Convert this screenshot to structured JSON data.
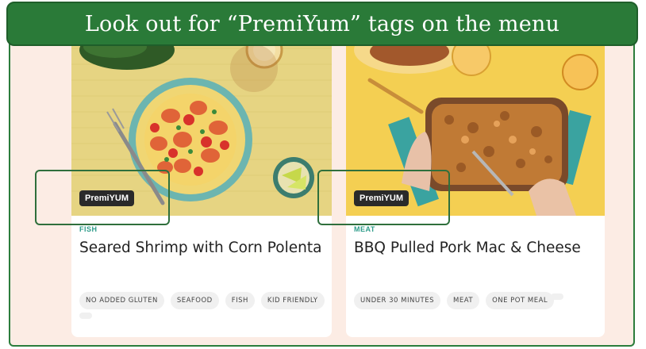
{
  "banner": {
    "text": "Look out for “PremiYum” tags on the menu"
  },
  "cards": [
    {
      "tag": "PremiYUM",
      "category": "FISH",
      "title": "Seared Shrimp with Corn Polenta",
      "chips": [
        "NO ADDED GLUTEN",
        "SEAFOOD",
        "FISH",
        "KID FRIENDLY"
      ]
    },
    {
      "tag": "PremiYUM",
      "category": "MEAT",
      "title": "BBQ Pulled Pork Mac & Cheese",
      "chips": [
        "UNDER 30 MINUTES",
        "MEAT",
        "ONE POT MEAL"
      ]
    }
  ],
  "colors": {
    "banner": "#2a7a38",
    "highlight": "#2f6f3c",
    "category": "#2e9c8a",
    "background": "#fcece4"
  },
  "icons": [
    "fork-icon",
    "lime-icon"
  ]
}
